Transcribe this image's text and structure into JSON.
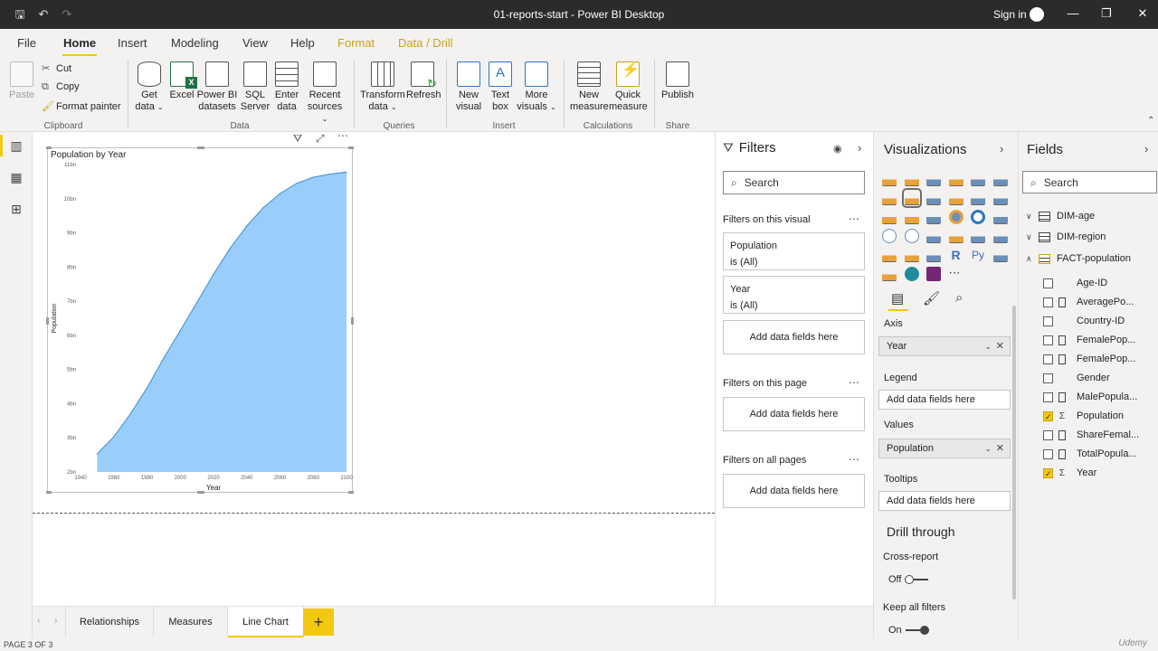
{
  "window": {
    "title": "01-reports-start - Power BI Desktop",
    "sign_in": "Sign in"
  },
  "menu": {
    "tabs": [
      "File",
      "Home",
      "Insert",
      "Modeling",
      "View",
      "Help",
      "Format",
      "Data / Drill"
    ],
    "active": "Home"
  },
  "ribbon": {
    "clipboard": {
      "paste": "Paste",
      "cut": "Cut",
      "copy": "Copy",
      "format_painter": "Format painter",
      "group": "Clipboard"
    },
    "data": {
      "get_data": [
        "Get",
        "data"
      ],
      "excel": "Excel",
      "pbi_datasets": [
        "Power BI",
        "datasets"
      ],
      "sql_server": [
        "SQL",
        "Server"
      ],
      "enter_data": [
        "Enter",
        "data"
      ],
      "recent_sources": [
        "Recent",
        "sources"
      ],
      "group": "Data"
    },
    "queries": {
      "transform_data": [
        "Transform",
        "data"
      ],
      "refresh": "Refresh",
      "group": "Queries"
    },
    "insert": {
      "new_visual": [
        "New",
        "visual"
      ],
      "text_box": [
        "Text",
        "box"
      ],
      "more_visuals": [
        "More",
        "visuals"
      ],
      "group": "Insert"
    },
    "calculations": {
      "new_measure": [
        "New",
        "measure"
      ],
      "quick_measure": [
        "Quick",
        "measure"
      ],
      "group": "Calculations"
    },
    "share": {
      "publish": "Publish",
      "group": "Share"
    }
  },
  "visual": {
    "title": "Population by Year",
    "chart_data": {
      "type": "area",
      "title": "Population by Year",
      "xlabel": "Year",
      "ylabel": "Population",
      "x_ticks": [
        "1940",
        "1960",
        "1980",
        "2000",
        "2020",
        "2040",
        "2060",
        "2080",
        "2100"
      ],
      "y_ticks": [
        "2bn",
        "3bn",
        "4bn",
        "5bn",
        "6bn",
        "7bn",
        "8bn",
        "9bn",
        "10bn",
        "11bn"
      ],
      "xlim": [
        1940,
        2100
      ],
      "ylim": [
        2,
        11
      ],
      "x": [
        1950,
        1960,
        1970,
        1980,
        1990,
        2000,
        2010,
        2020,
        2030,
        2040,
        2050,
        2060,
        2070,
        2080,
        2090,
        2100
      ],
      "values": [
        2.53,
        3.03,
        3.7,
        4.46,
        5.33,
        6.14,
        6.96,
        7.79,
        8.55,
        9.2,
        9.74,
        10.15,
        10.45,
        10.63,
        10.72,
        10.78
      ],
      "series": [
        {
          "values": [
            2.53,
            3.03,
            3.7,
            4.46,
            5.33,
            6.14,
            6.96,
            7.79,
            8.55,
            9.2,
            9.74,
            10.15,
            10.45,
            10.63,
            10.72,
            10.78
          ]
        }
      ],
      "fill_color": "#99cdfa",
      "line_color": "#3a8fd6",
      "grid": false,
      "legend": "none"
    }
  },
  "filters": {
    "title": "Filters",
    "search_placeholder": "Search",
    "on_visual_label": "Filters on this visual",
    "cards": [
      {
        "field": "Population",
        "value": "is (All)"
      },
      {
        "field": "Year",
        "value": "is (All)"
      }
    ],
    "add_fields": "Add data fields here",
    "on_page_label": "Filters on this page",
    "all_pages_label": "Filters on all pages"
  },
  "visualizations": {
    "title": "Visualizations",
    "axis_label": "Axis",
    "axis_value": "Year",
    "legend_label": "Legend",
    "values_label": "Values",
    "values_value": "Population",
    "tooltips_label": "Tooltips",
    "add_fields": "Add data fields here",
    "drill_title": "Drill through",
    "cross_report_label": "Cross-report",
    "cross_report_state": "Off",
    "keep_filters_label": "Keep all filters",
    "keep_filters_state": "On",
    "py_label": "Py",
    "r_label": "R"
  },
  "fields": {
    "title": "Fields",
    "search_placeholder": "Search",
    "tables": [
      "DIM-age",
      "DIM-region",
      "FACT-population"
    ],
    "items": [
      {
        "name": "Age-ID",
        "checked": false,
        "type": "plain"
      },
      {
        "name": "AveragePo...",
        "checked": false,
        "type": "calc"
      },
      {
        "name": "Country-ID",
        "checked": false,
        "type": "plain"
      },
      {
        "name": "FemalePop...",
        "checked": false,
        "type": "calc"
      },
      {
        "name": "FemalePop...",
        "checked": false,
        "type": "calc"
      },
      {
        "name": "Gender",
        "checked": false,
        "type": "plain"
      },
      {
        "name": "MalePopula...",
        "checked": false,
        "type": "calc"
      },
      {
        "name": "Population",
        "checked": true,
        "type": "sum"
      },
      {
        "name": "ShareFemal...",
        "checked": false,
        "type": "calc"
      },
      {
        "name": "TotalPopula...",
        "checked": false,
        "type": "calc"
      },
      {
        "name": "Year",
        "checked": true,
        "type": "sum"
      }
    ]
  },
  "pages": {
    "tabs": [
      "Relationships",
      "Measures",
      "Line Chart"
    ],
    "active": "Line Chart",
    "add": "+"
  },
  "status": {
    "page_indicator": "PAGE 3 OF 3",
    "watermark": "Udemy"
  },
  "colors": {
    "accent": "#f2c811",
    "titlebar": "#2b2b2b",
    "area_fill": "#99cdfa"
  }
}
